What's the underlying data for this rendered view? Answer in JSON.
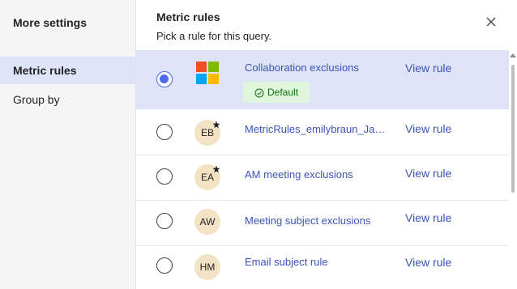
{
  "sidebar": {
    "title": "More settings",
    "items": [
      {
        "label": "Metric rules",
        "selected": true
      },
      {
        "label": "Group by",
        "selected": false
      }
    ]
  },
  "panel": {
    "title": "Metric rules",
    "subtitle": "Pick a rule for this query.",
    "close_icon": "close-icon"
  },
  "rules": [
    {
      "name": "Collaboration exclusions",
      "avatar": "",
      "icon": "microsoft-logo-icon",
      "badge": "Default",
      "selected": true,
      "action": "View rule",
      "starred": false
    },
    {
      "name": "MetricRules_emilybraun_Jan...",
      "avatar": "EB",
      "selected": false,
      "action": "View rule",
      "starred": true
    },
    {
      "name": "AM meeting exclusions",
      "avatar": "EA",
      "selected": false,
      "action": "View rule",
      "starred": true
    },
    {
      "name": "Meeting subject exclusions",
      "avatar": "AW",
      "selected": false,
      "action": "View rule",
      "starred": false
    },
    {
      "name": "Email subject rule",
      "avatar": "HM",
      "selected": false,
      "action": "View rule",
      "starred": false
    }
  ],
  "colors": {
    "accent": "#4f6bed",
    "link": "#3b53b8",
    "selected_bg": "#dfe3f8",
    "badge_bg": "#dff6dd",
    "badge_text": "#0e700e",
    "avatar_bg": "#f3e2c3"
  }
}
